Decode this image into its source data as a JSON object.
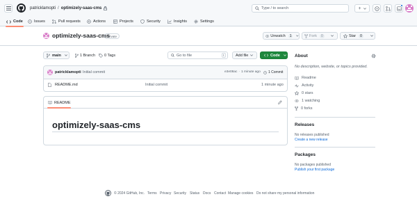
{
  "header": {
    "owner": "patricklamopti",
    "separator": "/",
    "repo": "optimizely-saas-cms",
    "search_placeholder": "Type / to search",
    "plus_label": "+"
  },
  "repo_nav": {
    "tabs": [
      {
        "label": "Code"
      },
      {
        "label": "Issues"
      },
      {
        "label": "Pull requests"
      },
      {
        "label": "Actions"
      },
      {
        "label": "Projects"
      },
      {
        "label": "Security"
      },
      {
        "label": "Insights"
      },
      {
        "label": "Settings"
      }
    ]
  },
  "title_row": {
    "repo_name": "optimizely-saas-cms",
    "visibility": "Private",
    "unwatch_label": "Unwatch",
    "unwatch_count": "1",
    "fork_label": "Fork",
    "fork_count": "0",
    "star_label": "Star",
    "star_count": "0"
  },
  "toolbar": {
    "branch": "main",
    "branches": "1 Branch",
    "tags": "0 Tags",
    "goto_placeholder": "Go to file",
    "goto_key": "t",
    "add_file": "Add file",
    "code_button": "Code"
  },
  "commit_bar": {
    "author": "patricklamopti",
    "message": "Initial commit",
    "hash": "e3e08ac",
    "dot": "·",
    "time": "1 minute ago",
    "commits": "1 Commit"
  },
  "files": [
    {
      "name": "README.md",
      "message": "Initial commit",
      "time": "1 minute ago"
    }
  ],
  "readme": {
    "tab_label": "README",
    "heading": "optimizely-saas-cms"
  },
  "about": {
    "title": "About",
    "description": "No description, website, or topics provided.",
    "items": [
      {
        "label": "Readme"
      },
      {
        "label": "Activity"
      },
      {
        "label": "0 stars"
      },
      {
        "label": "1 watching"
      },
      {
        "label": "0 forks"
      }
    ]
  },
  "releases": {
    "title": "Releases",
    "none_text": "No releases published",
    "link": "Create a new release"
  },
  "packages": {
    "title": "Packages",
    "none_text": "No packages published",
    "link": "Publish your first package"
  },
  "footer": {
    "copyright": "© 2024 GitHub, Inc.",
    "links": [
      {
        "label": "Terms"
      },
      {
        "label": "Privacy"
      },
      {
        "label": "Security"
      },
      {
        "label": "Status"
      },
      {
        "label": "Docs"
      },
      {
        "label": "Contact"
      },
      {
        "label": "Manage cookies"
      },
      {
        "label": "Do not share my personal information"
      }
    ]
  },
  "colors": {
    "accent": "#0969da",
    "code_button": "#1f883d",
    "tab_underline": "#fd8c73",
    "avatar": "#d97fc9"
  }
}
